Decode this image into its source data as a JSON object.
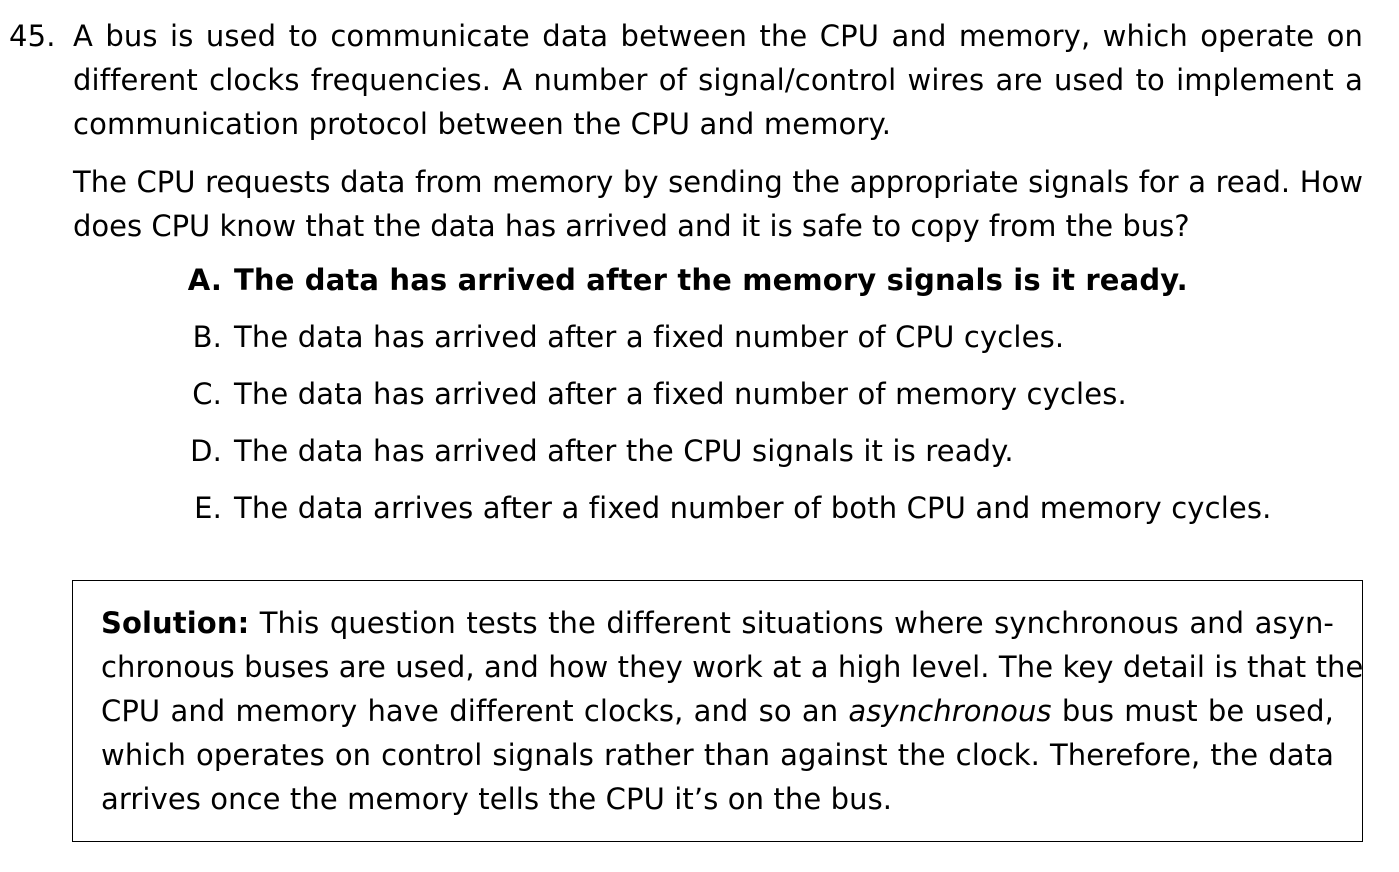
{
  "question": {
    "number": "45.",
    "stem_lines": [
      "A bus is used to communicate data between the CPU and memory, which operate on",
      "different clocks frequencies.  A number of signal/control wires are used to implement a",
      "communication protocol between the CPU and memory."
    ],
    "prompt_lines": [
      "The CPU requests data from memory by sending the appropriate signals for a read.  How",
      "does CPU know that the data has arrived and it is safe to copy from the bus?"
    ]
  },
  "choices": [
    {
      "letter": "A.",
      "text": "The data has arrived after the memory signals is it ready."
    },
    {
      "letter": "B.",
      "text": "The data has arrived after a fixed number of CPU cycles."
    },
    {
      "letter": "C.",
      "text": "The data has arrived after a fixed number of memory cycles."
    },
    {
      "letter": "D.",
      "text": "The data has arrived after the CPU signals it is ready."
    },
    {
      "letter": "E.",
      "text": "The data arrives after a fixed number of both CPU and memory cycles."
    }
  ],
  "solution": {
    "label": "Solution:",
    "line1": "This question tests the different situations where synchronous and asyn-",
    "line2": "chronous buses are used, and how they work at a high level.  The key detail is that the",
    "line3_before": "CPU and memory have different clocks, and so an ",
    "line3_emph": "asynchronous",
    "line3_after": " bus must be used,",
    "line4": "which operates on control signals rather than against the clock.  Therefore, the data",
    "line5": "arrives once the memory tells the CPU it’s on the bus."
  }
}
